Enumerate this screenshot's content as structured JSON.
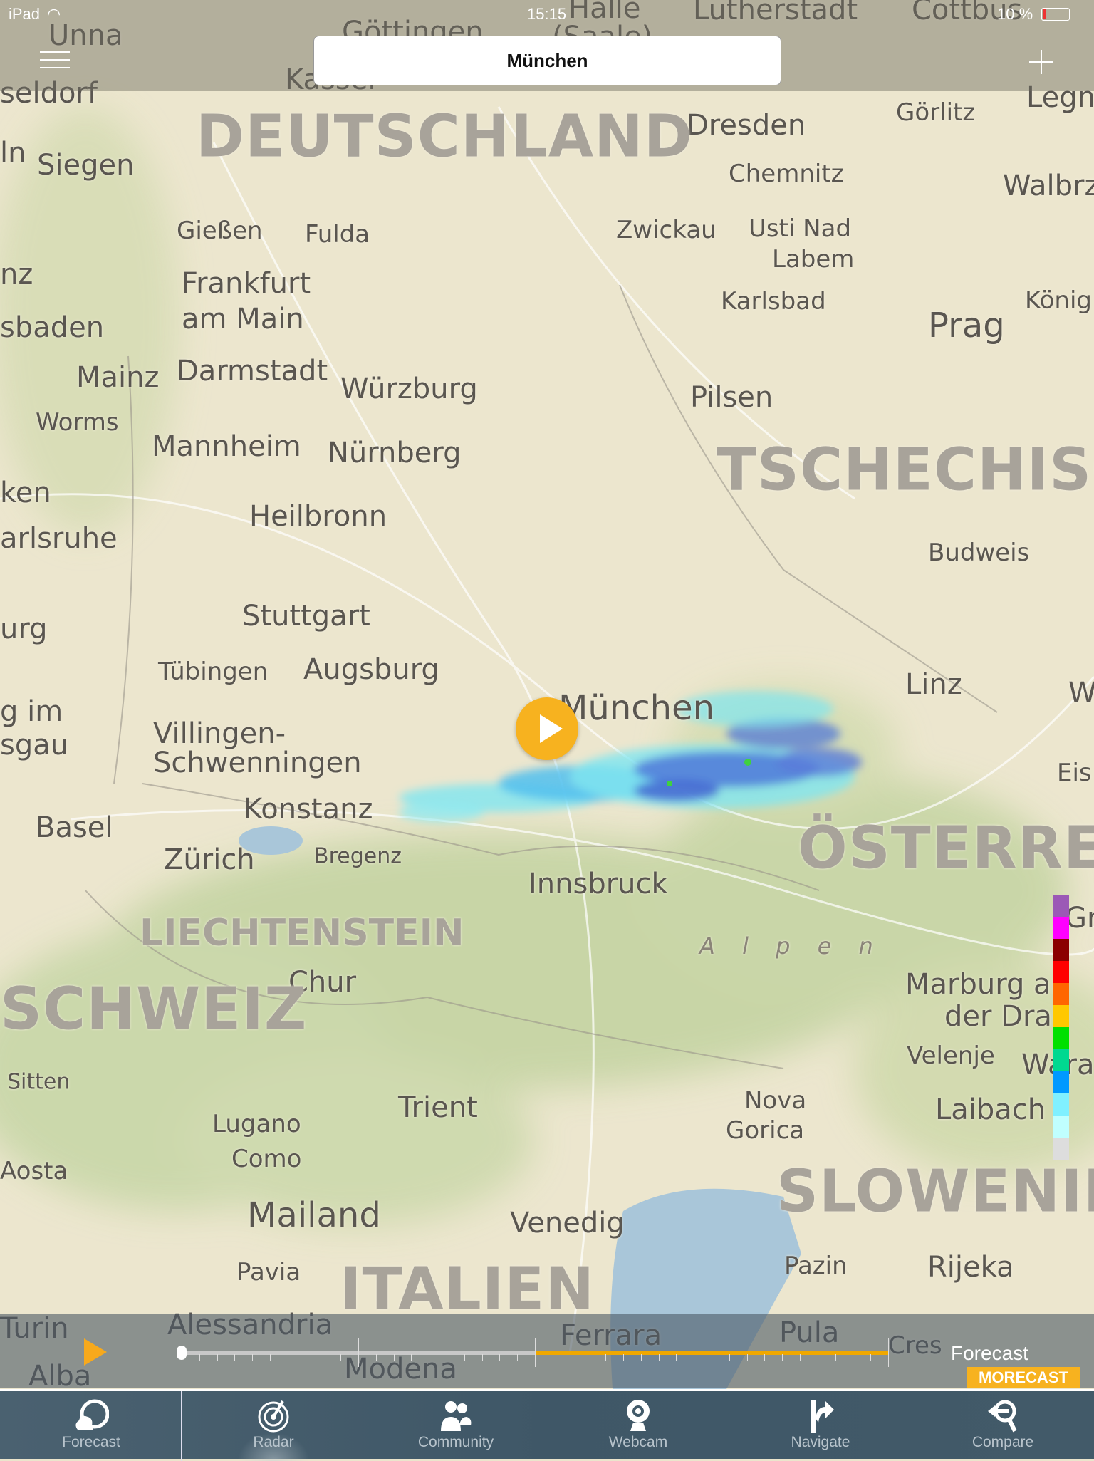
{
  "status_bar": {
    "device": "iPad",
    "time": "15:15",
    "battery": "10 %"
  },
  "search": {
    "location": "München"
  },
  "map": {
    "labels": [
      "Unna",
      "Kassel",
      "Göttingen",
      "(Saale)",
      "Halle",
      "Lutherstadt",
      "Cottbus",
      "seldorf",
      "Dresden",
      "Görlitz",
      "Legn",
      "Chemnitz",
      "Walbrz",
      "ln",
      "Siegen",
      "Gießen",
      "Fulda",
      "Zwickau",
      "Usti Nad",
      "Labem",
      "Frankfurt",
      "am Main",
      "Karlsbad",
      "Prag",
      "König",
      "sbaden",
      "nz",
      "Mainz",
      "Darmstadt",
      "Würzburg",
      "Worms",
      "Pilsen",
      "Mannheim",
      "Nürnberg",
      "ken",
      "Heilbronn",
      "arlsruhe",
      "Budweis",
      "urg",
      "Stuttgart",
      "Tübingen",
      "Augsburg",
      "Linz",
      "W",
      "München",
      "g im",
      "sgau",
      "Villingen-",
      "Schwenningen",
      "Eis",
      "Konstanz",
      "Basel",
      "Zürich",
      "Bregenz",
      "Innsbruck",
      "Gr",
      "Chur",
      "Marburg an",
      "der Drau",
      "Velenje",
      "Wara",
      "Sitten",
      "Trient",
      "Nova",
      "Gorica",
      "Laibach",
      "Lugano",
      "Como",
      "Aosta",
      "Mailand",
      "Venedig",
      "Pazin",
      "Rijeka",
      "Pavia",
      "Turin",
      "Alessandria",
      "Ferrara",
      "Pula",
      "Cres",
      "Modena",
      "Alba"
    ],
    "regions": [
      "DEUTSCHLAND",
      "TSCHECHISCH",
      "ÖSTERREIC",
      "LIECHTENSTEIN",
      "SCHWEIZ",
      "SLOWENIEN",
      "ITALIEN"
    ],
    "feature": "A l p e n",
    "legend_colors": [
      "#9b59b6",
      "#ff00ff",
      "#8b0000",
      "#ff0000",
      "#ff6600",
      "#ffc800",
      "#00e000",
      "#00d890",
      "#0099ff",
      "#80f0ff",
      "#c0ffff",
      "#dddddd"
    ]
  },
  "timeline": {
    "progress_start_fraction": 0.5,
    "forecast_label": "Forecast",
    "brand": "MORECAST",
    "accent": "#f7b21f"
  },
  "tabs": [
    {
      "label": "Forecast",
      "icon": "forecast-icon"
    },
    {
      "label": "Radar",
      "icon": "radar-icon",
      "active": true
    },
    {
      "label": "Community",
      "icon": "community-icon"
    },
    {
      "label": "Webcam",
      "icon": "webcam-icon"
    },
    {
      "label": "Navigate",
      "icon": "navigate-icon"
    },
    {
      "label": "Compare",
      "icon": "compare-icon"
    }
  ]
}
